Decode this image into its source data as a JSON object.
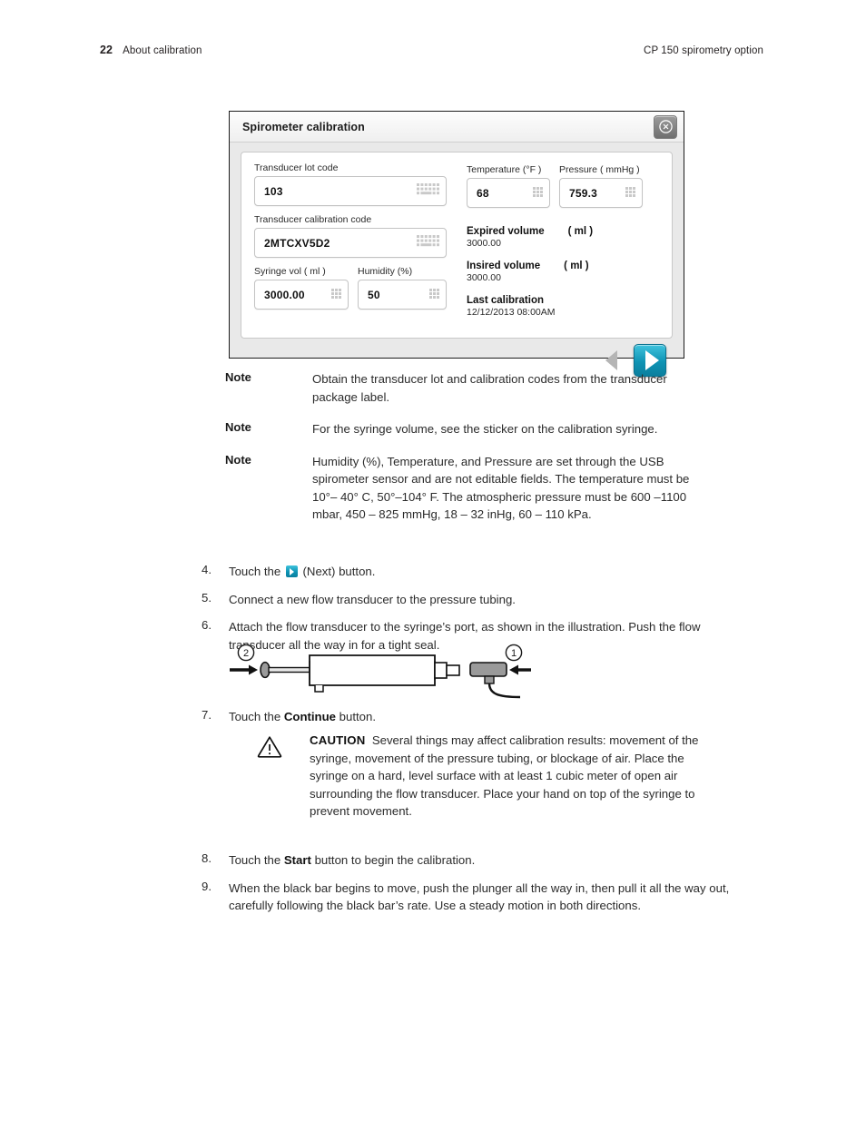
{
  "header": {
    "page_number": "22",
    "section": "About calibration",
    "document_title": "CP 150 spirometry option"
  },
  "dialog": {
    "title": "Spirometer calibration",
    "close_icon": "close-circle-icon",
    "fields": {
      "lot_code": {
        "label": "Transducer lot code",
        "value": "103",
        "icon": "keyboard-icon"
      },
      "calibration_code": {
        "label": "Transducer calibration code",
        "value": "2MTCXV5D2",
        "icon": "keyboard-icon"
      },
      "syringe_vol": {
        "label": "Syringe vol  (  ml  )",
        "value": "3000.00",
        "icon": "keypad-icon"
      },
      "humidity": {
        "label": "Humidity      (%)",
        "value": "50",
        "icon": "keypad-icon"
      },
      "temperature": {
        "label": "Temperature",
        "unit": "(°F )",
        "value": "68",
        "icon": "keypad-icon"
      },
      "pressure": {
        "label": "Pressure",
        "unit": "( mmHg  )",
        "value": "759.3",
        "icon": "keypad-icon"
      }
    },
    "readouts": [
      {
        "label": "Expired volume",
        "unit": "( ml  )",
        "value": "3000.00"
      },
      {
        "label": "Insired volume",
        "unit": "( ml  )",
        "value": "3000.00"
      },
      {
        "label": "Last calibration",
        "unit": "",
        "value": "12/12/2013  08:00AM"
      }
    ],
    "nav": {
      "back_icon": "triangle-left-icon",
      "next_icon": "triangle-right-icon"
    }
  },
  "notes": [
    {
      "label": "Note",
      "text": "Obtain the transducer lot and calibration codes from the transducer package label."
    },
    {
      "label": "Note",
      "text": "For the syringe volume, see the sticker on the calibration syringe."
    },
    {
      "label": "Note",
      "text": "Humidity (%), Temperature, and Pressure are set through the USB spirometer sensor and are not editable fields. The temperature must be 10°– 40° C, 50°–104° F. The atmospheric pressure must be 600 –1100 mbar, 450 – 825 mmHg, 18 – 32 inHg, 60 – 110 kPa."
    }
  ],
  "steps": {
    "step4": {
      "number": "4.",
      "text_before": "Touch the ",
      "text_after": " (Next) button."
    },
    "step5": {
      "number": "5.",
      "text": "Connect a new flow transducer to the pressure tubing."
    },
    "step6": {
      "number": "6.",
      "text": "Attach the flow transducer to the syringe’s port, as shown in the illustration. Push the flow transducer all the way in for a tight seal."
    },
    "step7": {
      "number": "7.",
      "text_before": "Touch the ",
      "bold": "Continue",
      "text_after": " button."
    },
    "step8": {
      "number": "8.",
      "text_before": "Touch the ",
      "bold": "Start",
      "text_after": " button to begin the calibration."
    },
    "step9": {
      "number": "9.",
      "text": "When the black bar begins to move, push the plunger all the way in, then pull it all the way out, carefully following the black bar’s rate. Use a steady motion in both directions."
    }
  },
  "illustration": {
    "callout_1": "1",
    "callout_2": "2",
    "alt": "syringe with flow transducer attached"
  },
  "caution": {
    "icon": "warning-triangle-icon",
    "label": "CAUTION",
    "text": "Several things may affect calibration results: movement of the syringe, movement of the pressure tubing, or blockage of air. Place the syringe on a hard, level surface with at least 1 cubic meter of open air surrounding the flow transducer. Place your hand on top of the syringe to prevent movement."
  },
  "colors": {
    "accent_teal": "#0e93b4",
    "text": "#2b2b2b",
    "dialog_border": "#1c1c1c"
  }
}
